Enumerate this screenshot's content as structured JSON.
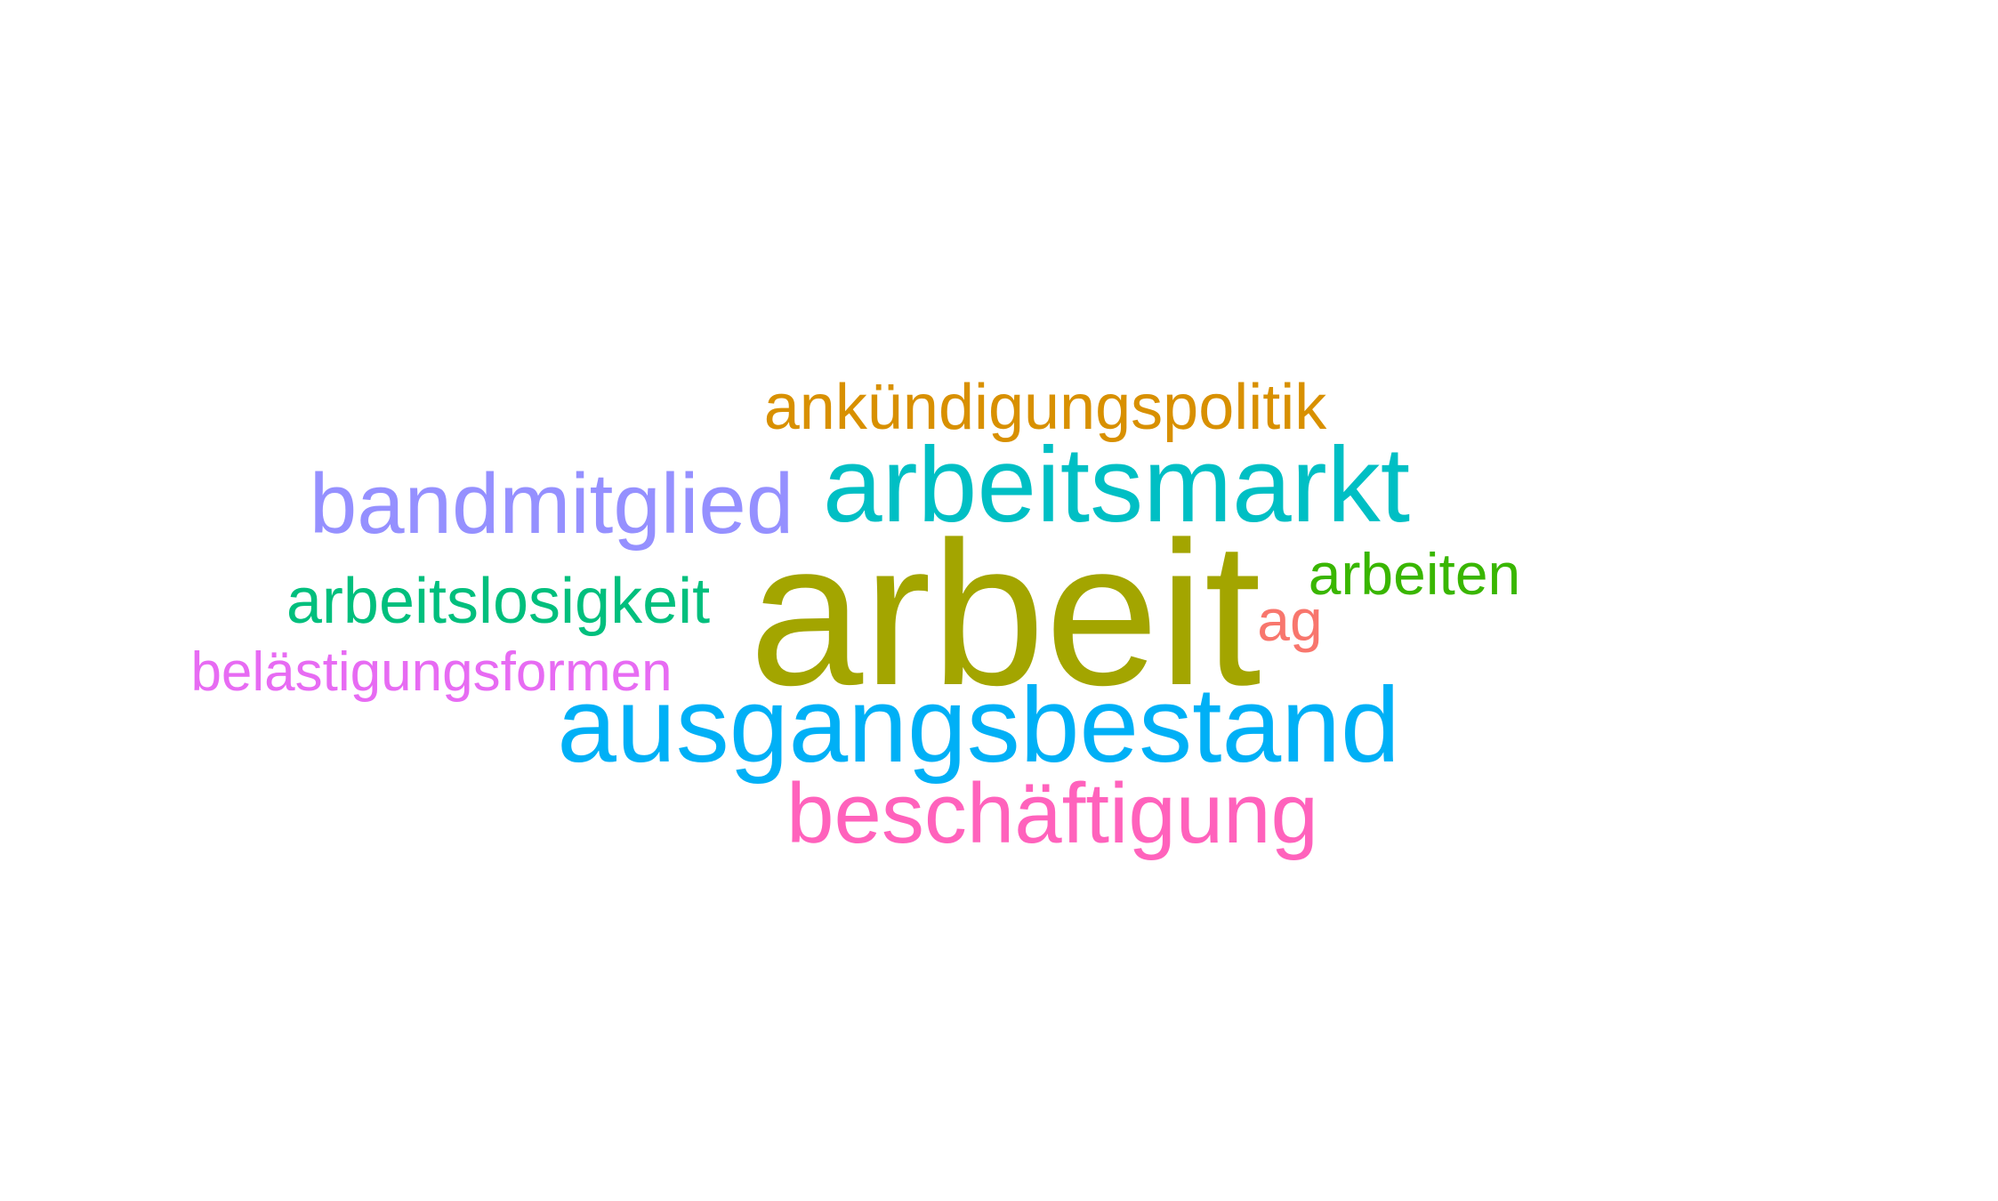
{
  "words": [
    {
      "text": "arbeit",
      "color": "#A3A500"
    },
    {
      "text": "ausgangsbestand",
      "color": "#00B0F6"
    },
    {
      "text": "arbeitsmarkt",
      "color": "#00BFC4"
    },
    {
      "text": "beschäftigung",
      "color": "#FF62BC"
    },
    {
      "text": "bandmitglied",
      "color": "#9590FF"
    },
    {
      "text": "ankündigungspolitik",
      "color": "#D89000"
    },
    {
      "text": "arbeitslosigkeit",
      "color": "#00BF7D"
    },
    {
      "text": "belästigungsformen",
      "color": "#E76BF3"
    },
    {
      "text": "arbeiten",
      "color": "#39B600"
    },
    {
      "text": "ag",
      "color": "#F8766D"
    }
  ]
}
